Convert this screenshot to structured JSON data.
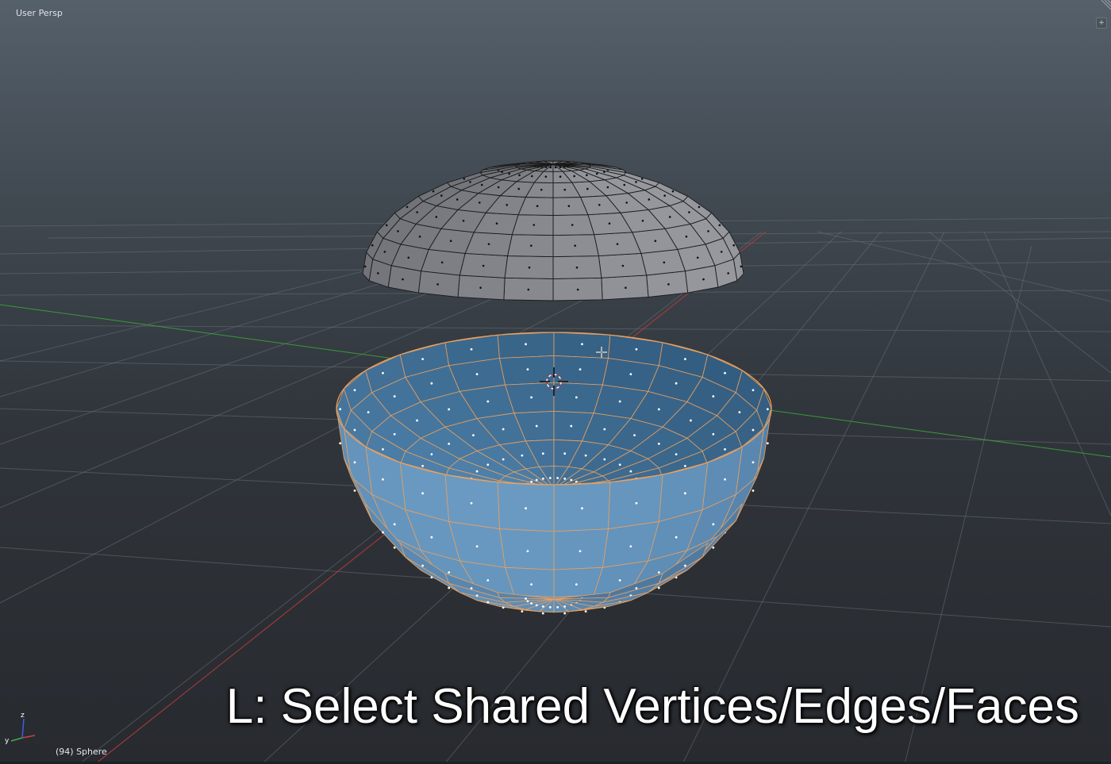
{
  "viewport": {
    "view_label": "User Persp",
    "object_info": "(94) Sphere",
    "hint": "L: Select Shared Vertices/Edges/Faces"
  },
  "colors": {
    "grid": "#6a7077",
    "x_axis": "#b33a3a",
    "y_axis": "#3a9a3a",
    "unselected_face": "#8d8f96",
    "unselected_edge": "#1a1a1a",
    "selected_face": "#5f88ad",
    "selected_inner_face": "#2f5878",
    "selected_edge": "#e8a060",
    "vertex_dot_selected": "#ffffff",
    "vertex_dot_unselected": "#111111"
  },
  "icons": {
    "corner_widget": "plus-icon",
    "cursor": "3d-cursor-icon",
    "mouse": "crosshair-icon",
    "axes": "axis-gizmo-icon"
  }
}
